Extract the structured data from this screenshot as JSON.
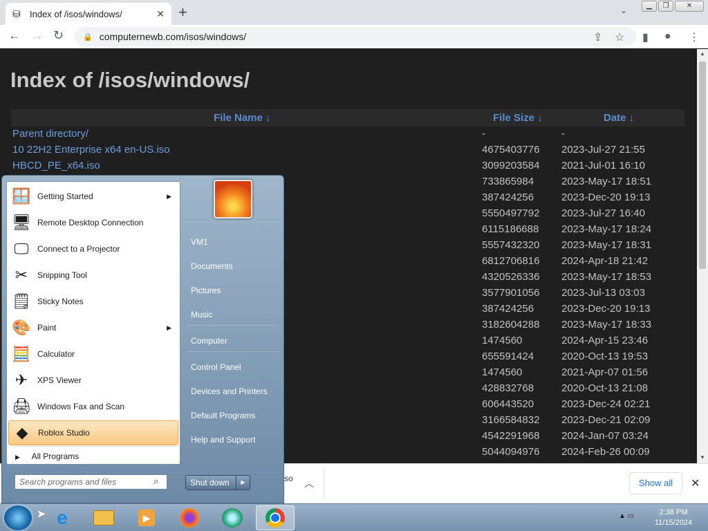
{
  "browser": {
    "tab_title": "Index of /isos/windows/",
    "url": "computernewb.com/isos/windows/",
    "download_fragment": "so",
    "show_all_label": "Show all"
  },
  "page": {
    "heading": "Index of /isos/windows/",
    "columns": {
      "name": "File Name  ↓",
      "size": "File Size  ↓",
      "date": "Date  ↓"
    },
    "rows": [
      {
        "name": "Parent directory/",
        "size": "-",
        "date": "-"
      },
      {
        "name": "10 22H2 Enterprise x64 en-US.iso",
        "size": "4675403776",
        "date": "2023-Jul-27 21:55"
      },
      {
        "name": "HBCD_PE_x64.iso",
        "size": "3099203584",
        "date": "2021-Jul-01 16:10"
      },
      {
        "name": "",
        "size": "733865984",
        "date": "2023-May-17 18:51"
      },
      {
        "name": "",
        "size": "387424256",
        "date": "2023-Dec-20 19:13"
      },
      {
        "name": "",
        "size": "5550497792",
        "date": "2023-Jul-27 16:40"
      },
      {
        "name": "",
        "size": "6115186688",
        "date": "2023-May-17 18:24"
      },
      {
        "name": "",
        "size": "5557432320",
        "date": "2023-May-17 18:31"
      },
      {
        "name": "",
        "size": "6812706816",
        "date": "2024-Apr-18 21:42"
      },
      {
        "name": "",
        "size": "4320526336",
        "date": "2023-May-17 18:53"
      },
      {
        "name": "",
        "size": "3577901056",
        "date": "2023-Jul-13 03:03"
      },
      {
        "name": "",
        "size": "387424256",
        "date": "2023-Dec-20 19:13"
      },
      {
        "name": "",
        "size": "3182604288",
        "date": "2023-May-17 18:33"
      },
      {
        "name": "",
        "size": "1474560",
        "date": "2024-Apr-15 23:46"
      },
      {
        "name": "",
        "size": "655591424",
        "date": "2020-Oct-13 19:53"
      },
      {
        "name": "",
        "size": "1474560",
        "date": "2021-Apr-07 01:56"
      },
      {
        "name": "",
        "size": "428832768",
        "date": "2020-Oct-13 21:08"
      },
      {
        "name": "",
        "size": "606443520",
        "date": "2023-Dec-24 02:21"
      },
      {
        "name": "",
        "size": "3166584832",
        "date": "2023-Dec-21 02:09"
      },
      {
        "name": "",
        "size": "4542291968",
        "date": "2024-Jan-07 03:24"
      },
      {
        "name": "",
        "size": "5044094976",
        "date": "2024-Feb-26 00:09"
      }
    ]
  },
  "start_menu": {
    "programs": [
      {
        "label": "Getting Started",
        "icon": "getting-started-icon",
        "has_submenu": true
      },
      {
        "label": "Remote Desktop Connection",
        "icon": "remote-desktop-icon",
        "has_submenu": false
      },
      {
        "label": "Connect to a Projector",
        "icon": "projector-icon",
        "has_submenu": false
      },
      {
        "label": "Snipping Tool",
        "icon": "scissors-icon",
        "has_submenu": false
      },
      {
        "label": "Sticky Notes",
        "icon": "sticky-notes-icon",
        "has_submenu": false
      },
      {
        "label": "Paint",
        "icon": "paint-palette-icon",
        "has_submenu": true
      },
      {
        "label": "Calculator",
        "icon": "calculator-icon",
        "has_submenu": false
      },
      {
        "label": "XPS Viewer",
        "icon": "xps-viewer-icon",
        "has_submenu": false
      },
      {
        "label": "Windows Fax and Scan",
        "icon": "fax-icon",
        "has_submenu": false
      },
      {
        "label": "Roblox Studio",
        "icon": "roblox-studio-icon",
        "has_submenu": false,
        "highlighted": true
      }
    ],
    "all_programs": "All Programs",
    "search_placeholder": "Search programs and files",
    "right_items": [
      "VM1",
      "Documents",
      "Pictures",
      "Music",
      "Computer",
      "Control Panel",
      "Devices and Printers",
      "Default Programs",
      "Help and Support"
    ],
    "shutdown_label": "Shut down"
  },
  "taskbar": {
    "apps": [
      "internet-explorer-icon",
      "file-explorer-icon",
      "media-player-icon",
      "firefox-icon",
      "app-icon",
      "chrome-icon"
    ],
    "time": "2:38 PM",
    "date": "11/15/2024"
  }
}
